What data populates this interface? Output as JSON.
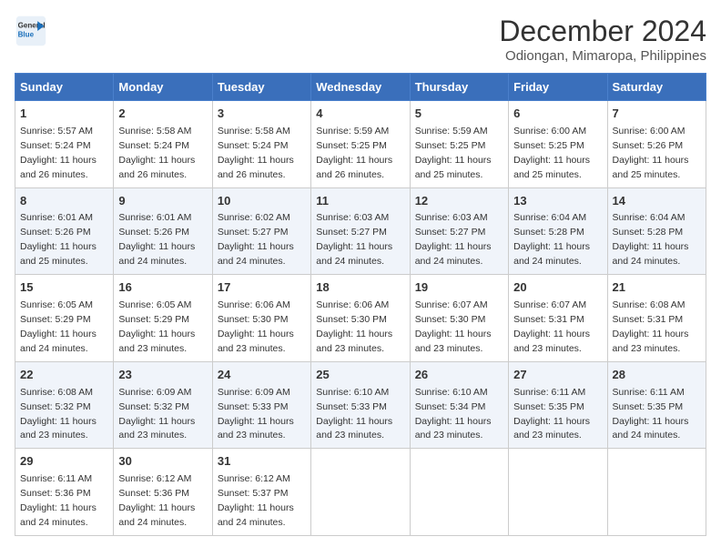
{
  "header": {
    "logo_line1": "General",
    "logo_line2": "Blue",
    "month_title": "December 2024",
    "subtitle": "Odiongan, Mimaropa, Philippines"
  },
  "weekdays": [
    "Sunday",
    "Monday",
    "Tuesday",
    "Wednesday",
    "Thursday",
    "Friday",
    "Saturday"
  ],
  "weeks": [
    [
      {
        "day": "1",
        "info": "Sunrise: 5:57 AM\nSunset: 5:24 PM\nDaylight: 11 hours\nand 26 minutes."
      },
      {
        "day": "2",
        "info": "Sunrise: 5:58 AM\nSunset: 5:24 PM\nDaylight: 11 hours\nand 26 minutes."
      },
      {
        "day": "3",
        "info": "Sunrise: 5:58 AM\nSunset: 5:24 PM\nDaylight: 11 hours\nand 26 minutes."
      },
      {
        "day": "4",
        "info": "Sunrise: 5:59 AM\nSunset: 5:25 PM\nDaylight: 11 hours\nand 26 minutes."
      },
      {
        "day": "5",
        "info": "Sunrise: 5:59 AM\nSunset: 5:25 PM\nDaylight: 11 hours\nand 25 minutes."
      },
      {
        "day": "6",
        "info": "Sunrise: 6:00 AM\nSunset: 5:25 PM\nDaylight: 11 hours\nand 25 minutes."
      },
      {
        "day": "7",
        "info": "Sunrise: 6:00 AM\nSunset: 5:26 PM\nDaylight: 11 hours\nand 25 minutes."
      }
    ],
    [
      {
        "day": "8",
        "info": "Sunrise: 6:01 AM\nSunset: 5:26 PM\nDaylight: 11 hours\nand 25 minutes."
      },
      {
        "day": "9",
        "info": "Sunrise: 6:01 AM\nSunset: 5:26 PM\nDaylight: 11 hours\nand 24 minutes."
      },
      {
        "day": "10",
        "info": "Sunrise: 6:02 AM\nSunset: 5:27 PM\nDaylight: 11 hours\nand 24 minutes."
      },
      {
        "day": "11",
        "info": "Sunrise: 6:03 AM\nSunset: 5:27 PM\nDaylight: 11 hours\nand 24 minutes."
      },
      {
        "day": "12",
        "info": "Sunrise: 6:03 AM\nSunset: 5:27 PM\nDaylight: 11 hours\nand 24 minutes."
      },
      {
        "day": "13",
        "info": "Sunrise: 6:04 AM\nSunset: 5:28 PM\nDaylight: 11 hours\nand 24 minutes."
      },
      {
        "day": "14",
        "info": "Sunrise: 6:04 AM\nSunset: 5:28 PM\nDaylight: 11 hours\nand 24 minutes."
      }
    ],
    [
      {
        "day": "15",
        "info": "Sunrise: 6:05 AM\nSunset: 5:29 PM\nDaylight: 11 hours\nand 24 minutes."
      },
      {
        "day": "16",
        "info": "Sunrise: 6:05 AM\nSunset: 5:29 PM\nDaylight: 11 hours\nand 23 minutes."
      },
      {
        "day": "17",
        "info": "Sunrise: 6:06 AM\nSunset: 5:30 PM\nDaylight: 11 hours\nand 23 minutes."
      },
      {
        "day": "18",
        "info": "Sunrise: 6:06 AM\nSunset: 5:30 PM\nDaylight: 11 hours\nand 23 minutes."
      },
      {
        "day": "19",
        "info": "Sunrise: 6:07 AM\nSunset: 5:30 PM\nDaylight: 11 hours\nand 23 minutes."
      },
      {
        "day": "20",
        "info": "Sunrise: 6:07 AM\nSunset: 5:31 PM\nDaylight: 11 hours\nand 23 minutes."
      },
      {
        "day": "21",
        "info": "Sunrise: 6:08 AM\nSunset: 5:31 PM\nDaylight: 11 hours\nand 23 minutes."
      }
    ],
    [
      {
        "day": "22",
        "info": "Sunrise: 6:08 AM\nSunset: 5:32 PM\nDaylight: 11 hours\nand 23 minutes."
      },
      {
        "day": "23",
        "info": "Sunrise: 6:09 AM\nSunset: 5:32 PM\nDaylight: 11 hours\nand 23 minutes."
      },
      {
        "day": "24",
        "info": "Sunrise: 6:09 AM\nSunset: 5:33 PM\nDaylight: 11 hours\nand 23 minutes."
      },
      {
        "day": "25",
        "info": "Sunrise: 6:10 AM\nSunset: 5:33 PM\nDaylight: 11 hours\nand 23 minutes."
      },
      {
        "day": "26",
        "info": "Sunrise: 6:10 AM\nSunset: 5:34 PM\nDaylight: 11 hours\nand 23 minutes."
      },
      {
        "day": "27",
        "info": "Sunrise: 6:11 AM\nSunset: 5:35 PM\nDaylight: 11 hours\nand 23 minutes."
      },
      {
        "day": "28",
        "info": "Sunrise: 6:11 AM\nSunset: 5:35 PM\nDaylight: 11 hours\nand 24 minutes."
      }
    ],
    [
      {
        "day": "29",
        "info": "Sunrise: 6:11 AM\nSunset: 5:36 PM\nDaylight: 11 hours\nand 24 minutes."
      },
      {
        "day": "30",
        "info": "Sunrise: 6:12 AM\nSunset: 5:36 PM\nDaylight: 11 hours\nand 24 minutes."
      },
      {
        "day": "31",
        "info": "Sunrise: 6:12 AM\nSunset: 5:37 PM\nDaylight: 11 hours\nand 24 minutes."
      },
      null,
      null,
      null,
      null
    ]
  ]
}
